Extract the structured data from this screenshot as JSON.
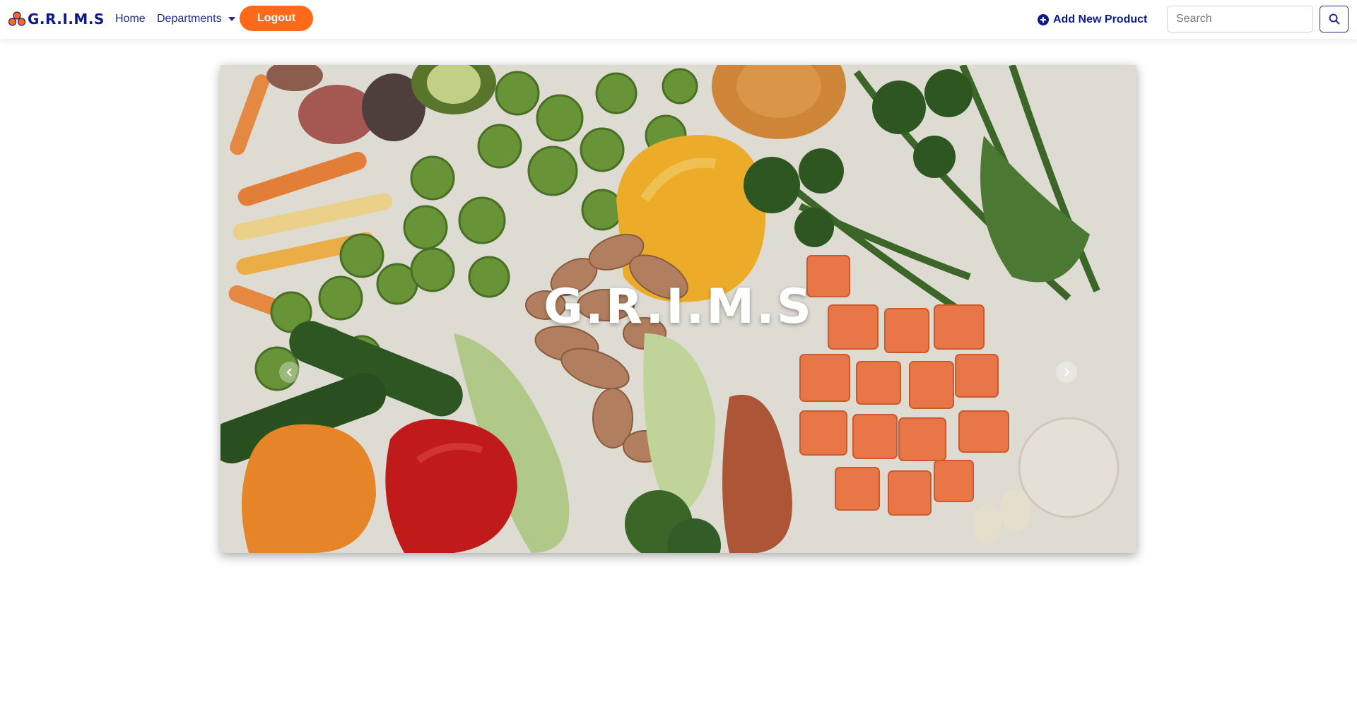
{
  "navbar": {
    "brand": "G.R.I.M.S",
    "brand_icon": "grims-logo-icon",
    "links": {
      "home": "Home",
      "departments": "Departments"
    },
    "logout_label": "Logout",
    "add_product_label": "Add New Product",
    "search": {
      "placeholder": "Search",
      "value": ""
    },
    "colors": {
      "primary": "#0d1a8a",
      "accent": "#ff6a1a"
    }
  },
  "carousel": {
    "caption": "G.R.I.M.S",
    "image": "vegetables-flatlay",
    "prev_icon": "chevron-left-icon",
    "next_icon": "chevron-right-icon"
  }
}
